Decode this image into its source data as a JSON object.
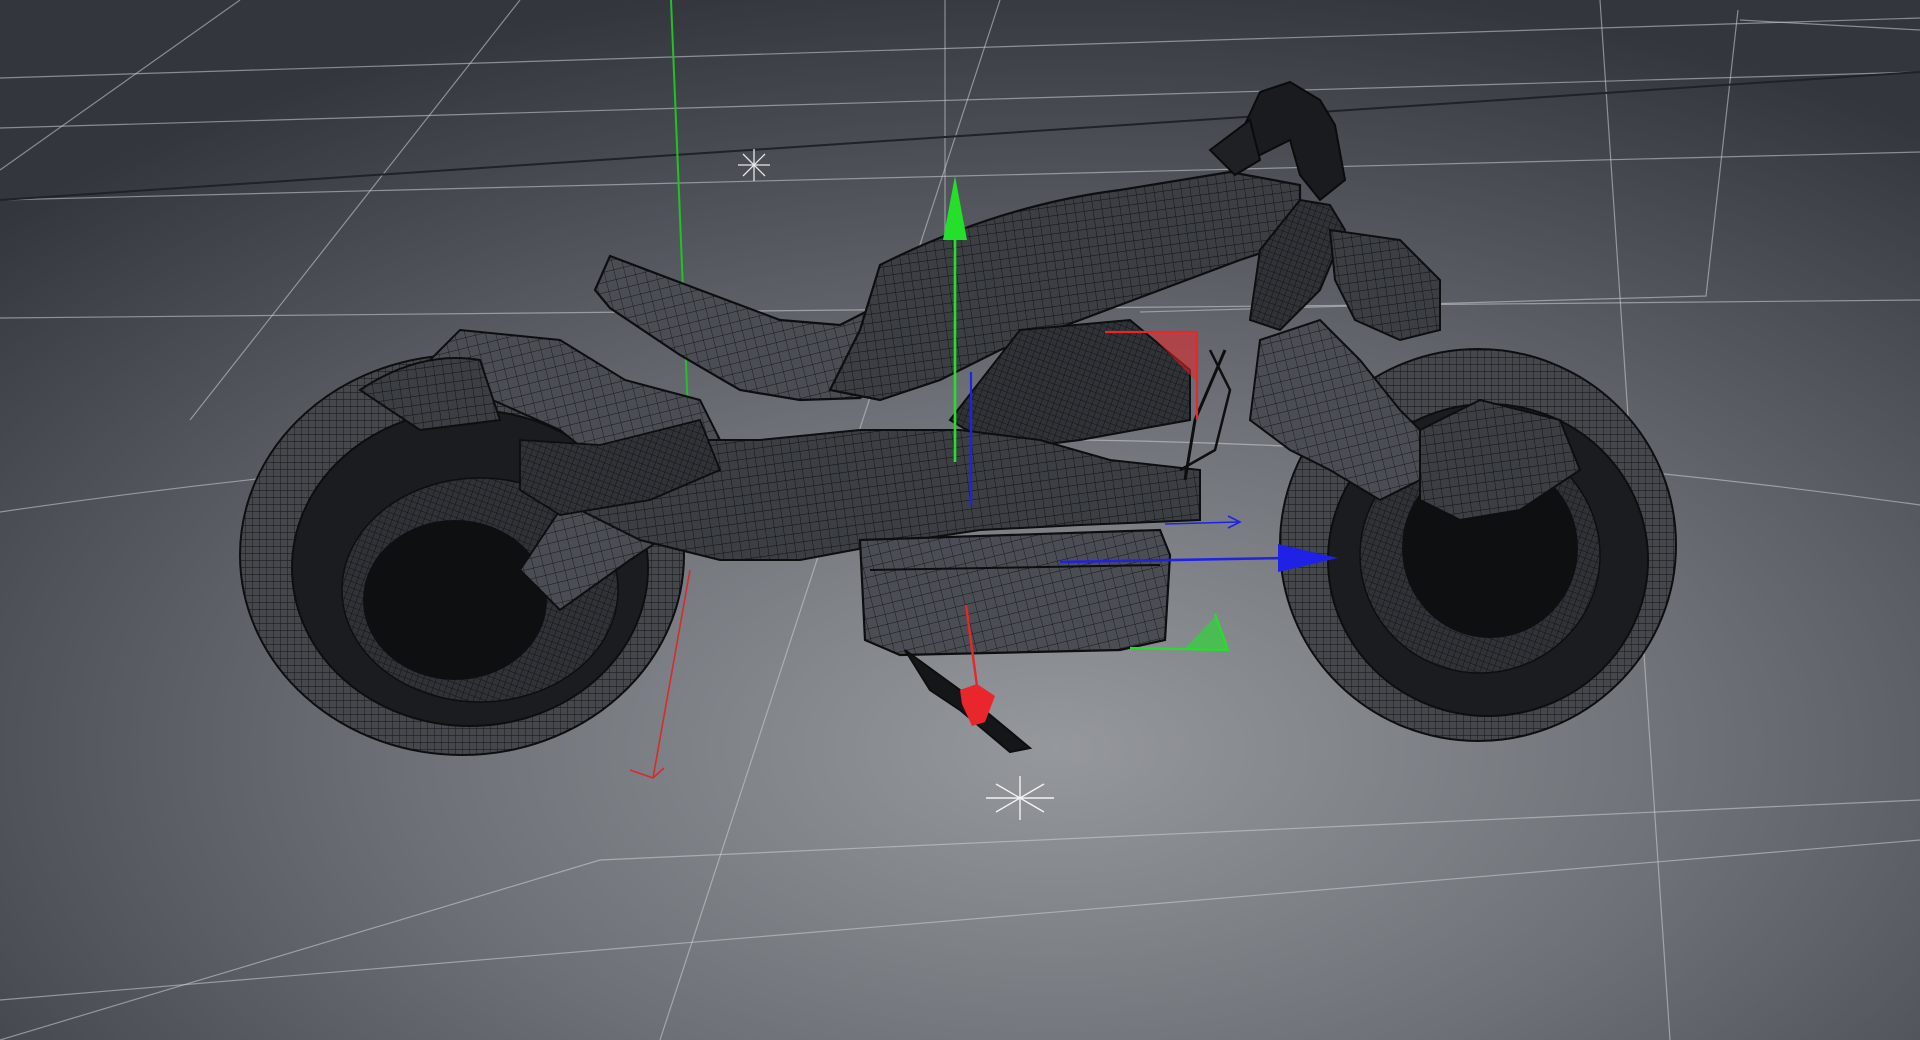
{
  "viewport": {
    "background_center": "#8a8d92",
    "background_edge": "#33373d",
    "grid_color": "#d9dadc",
    "grid_dark_line": "#23262a"
  },
  "model": {
    "name": "motorcycle-wireframe",
    "surface_color": "#3a3d42",
    "surface_dark": "#1c1e21",
    "wire_color": "#0d0e10"
  },
  "gizmo": {
    "x_axis_color": "#e8262b",
    "y_axis_color": "#25e02a",
    "z_axis_color": "#1f22e6"
  },
  "icons": [
    "light-star-icon",
    "light-star-icon"
  ]
}
